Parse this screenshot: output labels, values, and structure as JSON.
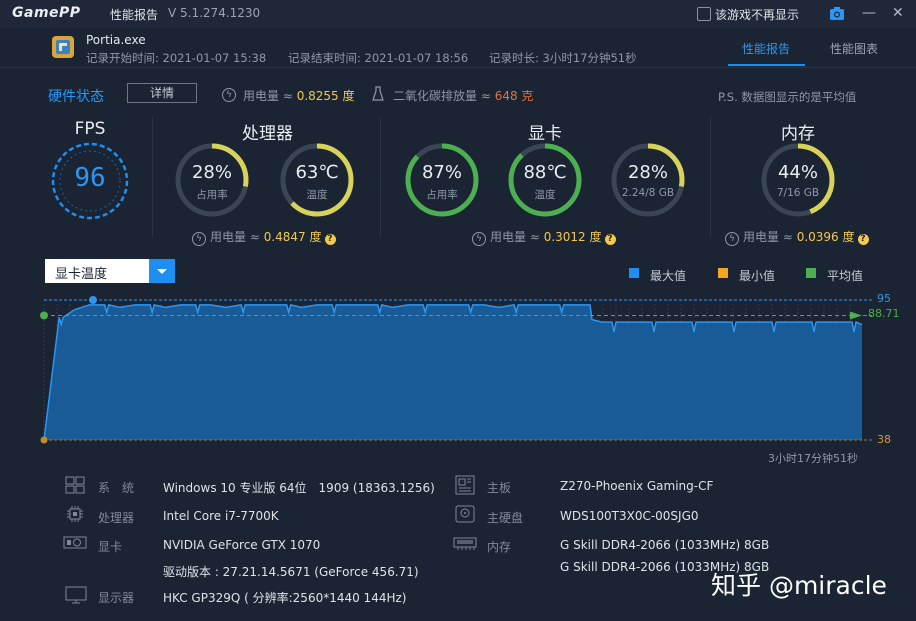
{
  "app": {
    "logo": "GamePP",
    "title": "性能报告",
    "version": "V 5.1.274.1230"
  },
  "topbar": {
    "dont_show_label": "该游戏不再显示",
    "camera_icon": "camera-icon",
    "minimize": "—",
    "close": "✕"
  },
  "header": {
    "exe_name": "Portia.exe",
    "start_time": "记录开始时间: 2021-01-07 15:38",
    "end_time": "记录结束时间: 2021-01-07 18:56",
    "duration": "记录时长: 3小时17分钟51秒",
    "tabs": [
      {
        "label": "性能报告",
        "active": true
      },
      {
        "label": "性能图表",
        "active": false
      }
    ]
  },
  "status": {
    "title": "硬件状态",
    "detail_button": "详情",
    "power_label": "用电量 ≈",
    "power_value": "0.8255 度",
    "co2_label": "二氧化碳排放量 ≈",
    "co2_value": "648 克",
    "note": "P.S. 数据图显示的是平均值"
  },
  "fps": {
    "title": "FPS",
    "value": "96"
  },
  "cpu": {
    "title": "处理器",
    "usage": {
      "value": "28%",
      "label": "占用率",
      "fraction": 0.28,
      "color": "#d8d15a"
    },
    "temp": {
      "value": "63℃",
      "label": "温度",
      "fraction": 0.63,
      "color": "#d8d15a"
    },
    "power_label": "用电量 ≈",
    "power_value": "0.4847 度"
  },
  "gpu": {
    "title": "显卡",
    "usage": {
      "value": "87%",
      "label": "占用率",
      "fraction": 0.87,
      "color": "#4caf50"
    },
    "temp": {
      "value": "88℃",
      "label": "温度",
      "fraction": 0.88,
      "color": "#4caf50"
    },
    "mem": {
      "value": "28%",
      "label": "2.24/8 GB",
      "fraction": 0.28,
      "color": "#d8d15a"
    },
    "power_label": "用电量 ≈",
    "power_value": "0.3012 度"
  },
  "ram": {
    "title": "内存",
    "usage": {
      "value": "44%",
      "label": "7/16 GB",
      "fraction": 0.44,
      "color": "#d8d15a"
    },
    "power_label": "用电量 ≈",
    "power_value": "0.0396 度"
  },
  "graph": {
    "selector": "显卡温度",
    "legend": [
      {
        "label": "最大值",
        "color": "#1f8ef1"
      },
      {
        "label": "最小值",
        "color": "#f5a623"
      },
      {
        "label": "平均值",
        "color": "#4caf50"
      }
    ],
    "max_label": "95",
    "avg_label": "88.71",
    "min_label": "38",
    "duration": "3小时17分钟51秒"
  },
  "chart_data": {
    "type": "area",
    "ylim": [
      38,
      95
    ],
    "max": 95,
    "min": 38,
    "average": 88.71,
    "series": [
      {
        "segment": "first_part_level",
        "values": [
          38,
          88,
          91,
          93,
          93,
          92,
          93,
          93,
          92,
          93,
          93,
          93,
          92,
          93,
          93,
          93,
          93,
          92,
          93,
          93,
          93,
          93,
          93,
          92,
          93,
          93,
          93,
          93,
          93,
          93,
          92,
          93,
          93,
          93,
          93,
          93,
          93
        ]
      },
      {
        "segment": "second_part_level",
        "values": [
          87,
          86,
          86,
          86,
          86,
          86,
          86,
          86,
          86,
          86,
          86,
          86,
          86,
          86,
          86,
          86,
          86,
          86,
          86,
          86,
          86,
          86,
          86,
          86,
          86,
          86,
          86,
          85
        ]
      }
    ]
  },
  "info": {
    "left": [
      {
        "label": "系　统",
        "value": "Windows 10 专业版 64位　1909 (18363.1256)"
      },
      {
        "label": "处理器",
        "value": "Intel Core i7-7700K"
      },
      {
        "label": "显卡",
        "value": "NVIDIA GeForce GTX 1070"
      },
      {
        "label": "",
        "value": "驱动版本 : 27.21.14.5671 (GeForce 456.71)"
      },
      {
        "label": "显示器",
        "value": "HKC GP329Q ( 分辨率:2560*1440 144Hz)"
      }
    ],
    "right": [
      {
        "label": "主板",
        "value": "Z270-Phoenix Gaming-CF"
      },
      {
        "label": "主硬盘",
        "value": "WDS100T3X0C-00SJG0"
      },
      {
        "label": "内存",
        "value": "G Skill DDR4-2066 (1033MHz) 8GB"
      },
      {
        "label": "",
        "value": "G Skill DDR4-2066 (1033MHz) 8GB"
      }
    ]
  },
  "watermark": "知乎 @miracle"
}
